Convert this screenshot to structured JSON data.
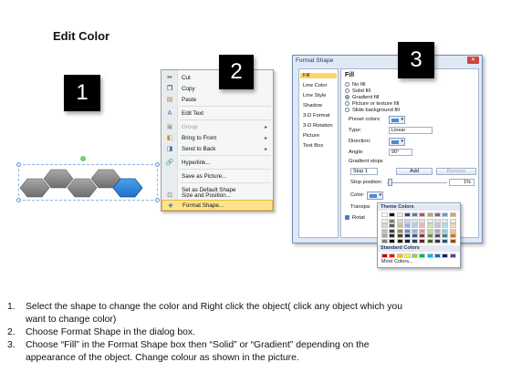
{
  "title": "Edit Color",
  "steps_numbers": {
    "one": "1",
    "two": "2",
    "three": "3"
  },
  "context_menu": {
    "items": [
      {
        "icon": "scissors-icon",
        "label": "Cut"
      },
      {
        "icon": "copy-icon",
        "label": "Copy"
      },
      {
        "icon": "paste-icon",
        "label": "Paste"
      },
      {
        "icon": "edit-text-icon",
        "label": "Edit Text"
      },
      {
        "icon": "group-icon",
        "label": "Group"
      },
      {
        "icon": "bring-front-icon",
        "label": "Bring to Front"
      },
      {
        "icon": "send-back-icon",
        "label": "Send to Back"
      },
      {
        "icon": "hyperlink-icon",
        "label": "Hyperlink..."
      },
      {
        "icon": "",
        "label": "Save as Picture..."
      },
      {
        "icon": "",
        "label": "Set as Default Shape"
      },
      {
        "icon": "size-position-icon",
        "label": "Size and Position..."
      },
      {
        "icon": "format-shape-icon",
        "label": "Format Shape..."
      }
    ]
  },
  "dialog": {
    "title": "Format Shape",
    "categories": [
      "Fill",
      "Line Color",
      "Line Style",
      "Shadow",
      "3-D Format",
      "3-D Rotation",
      "Picture",
      "Text Box"
    ],
    "fill_heading": "Fill",
    "options": [
      "No fill",
      "Solid fill",
      "Gradient fill",
      "Picture or texture fill",
      "Slide background fill"
    ],
    "preset_label": "Preset colors:",
    "type_label": "Type:",
    "type_value": "Linear",
    "direction_label": "Direction:",
    "angle_label": "Angle:",
    "angle_value": "90°",
    "gradient_stops_label": "Gradient stops",
    "stop_value": "Stop 1",
    "add_label": "Add",
    "remove_label": "Remove",
    "stop_position_label": "Stop position:",
    "stop_position_value": "1%",
    "color_label": "Color:",
    "transparency_label": "Transpa",
    "rotate_label": "Rotat"
  },
  "palette": {
    "theme_label": "Theme Colors",
    "standard_label": "Standard Colors",
    "more_label": "More Colors...",
    "theme_top": [
      "#ffffff",
      "#000000",
      "#eeece1",
      "#1f497d",
      "#4f81bd",
      "#c0504d",
      "#9bbb59",
      "#8064a2",
      "#4bacc6",
      "#f79646"
    ],
    "theme_rows": [
      [
        "#f2f2f2",
        "#7f7f7f",
        "#ddd9c3",
        "#c6d9f0",
        "#dbe5f1",
        "#f2dcdb",
        "#ebf1dd",
        "#e5e0ec",
        "#dbeef3",
        "#fdeada"
      ],
      [
        "#d8d8d8",
        "#595959",
        "#c4bd97",
        "#8db3e2",
        "#b8cce4",
        "#e5b9b7",
        "#d7e3bc",
        "#ccc1d9",
        "#b7dde8",
        "#fbd5b5"
      ],
      [
        "#bfbfbf",
        "#3f3f3f",
        "#938953",
        "#548dd4",
        "#95b3d7",
        "#d99694",
        "#c3d69b",
        "#b2a2c7",
        "#92cddc",
        "#fac08f"
      ],
      [
        "#a5a5a5",
        "#262626",
        "#494429",
        "#17365d",
        "#366092",
        "#953734",
        "#76923c",
        "#5f497a",
        "#31859b",
        "#e36c09"
      ],
      [
        "#7f7f7f",
        "#0c0c0c",
        "#1d1b10",
        "#0f243e",
        "#244061",
        "#632423",
        "#4f6128",
        "#3f3151",
        "#205867",
        "#974806"
      ]
    ],
    "standard": [
      "#c00000",
      "#ff0000",
      "#ffc000",
      "#ffff00",
      "#92d050",
      "#00b050",
      "#00b0f0",
      "#0070c0",
      "#002060",
      "#7030a0"
    ]
  },
  "steps": [
    {
      "n": "1.",
      "line1": "Select the shape to change the color and Right click the object( click any object which you",
      "line2": "want to change color)"
    },
    {
      "n": "2.",
      "line1": "Choose Format Shape in the dialog box.",
      "line2": ""
    },
    {
      "n": "3.",
      "line1": "Choose “Fill” in the Format Shape box then “Solid” or “Gradient” depending on the",
      "line2": "appearance of the object. Change colour as shown in the picture."
    }
  ]
}
